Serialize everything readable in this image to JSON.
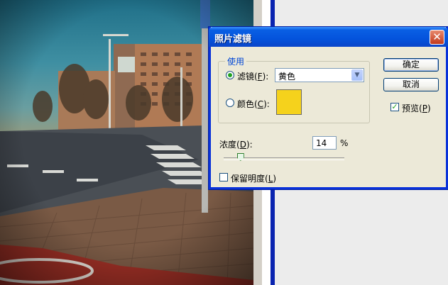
{
  "dialog": {
    "title": "照片滤镜",
    "close_glyph": "✕",
    "group_label": "使用",
    "filter_label": "滤镜(",
    "filter_key": "F",
    "filter_suffix": "):",
    "filter_selected": "黄色",
    "color_label": "颜色(",
    "color_key": "C",
    "color_suffix": "):",
    "color_swatch": "#f5d21c",
    "density_label": "浓度(",
    "density_key": "D",
    "density_suffix": "):",
    "density_value": "14",
    "percent": "%",
    "density_fraction": 0.14,
    "preserve_label": "保留明度(",
    "preserve_key": "L",
    "preserve_suffix": ")",
    "ok": "确定",
    "cancel": "取消",
    "preview_label": "预览(",
    "preview_key": "P",
    "preview_suffix": ")",
    "check_glyph": "✓",
    "arrow_glyph": "▼"
  }
}
